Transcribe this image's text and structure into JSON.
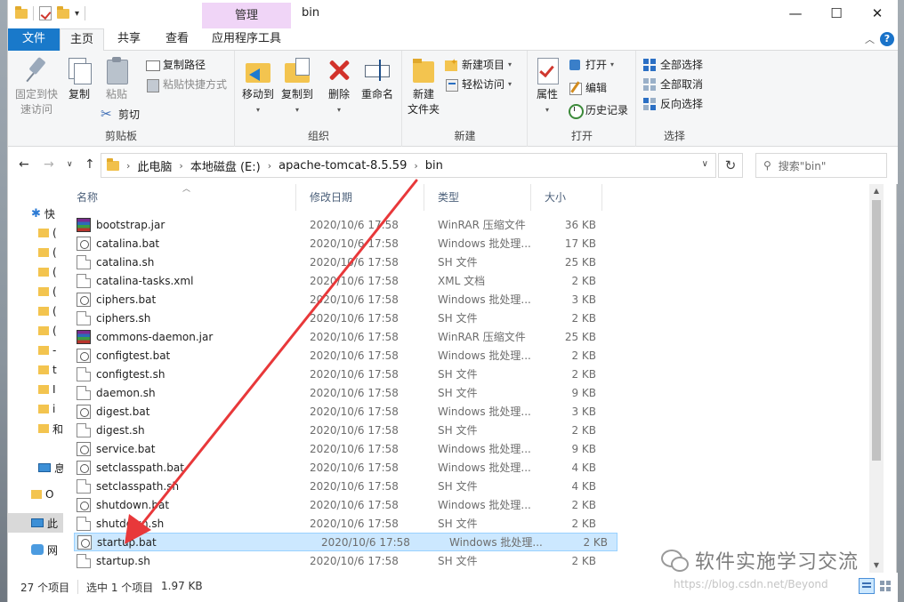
{
  "window": {
    "title": "bin",
    "manage_tab": "管理",
    "minimize": "—",
    "maximize": "☐",
    "close": "✕"
  },
  "tabs": {
    "file": "文件",
    "home": "主页",
    "share": "共享",
    "view": "查看",
    "app_tools": "应用程序工具",
    "help": "?"
  },
  "ribbon": {
    "clipboard": {
      "label": "剪贴板",
      "pin_quick_access": [
        "固定到快",
        "速访问"
      ],
      "copy": "复制",
      "paste": "粘贴",
      "copy_path": "复制路径",
      "paste_shortcut": "粘贴快捷方式",
      "cut": "剪切"
    },
    "organize": {
      "label": "组织",
      "move_to": "移动到",
      "copy_to": "复制到",
      "delete": "删除",
      "rename": "重命名"
    },
    "new": {
      "label": "新建",
      "new_item": "新建项目",
      "easy_access": "轻松访问",
      "new_folder": [
        "新建",
        "文件夹"
      ]
    },
    "open": {
      "label": "打开",
      "properties": "属性",
      "open": "打开",
      "edit": "编辑",
      "history": "历史记录"
    },
    "select": {
      "label": "选择",
      "select_all": "全部选择",
      "select_none": "全部取消",
      "invert": "反向选择"
    }
  },
  "address": {
    "crumbs": [
      "此电脑",
      "本地磁盘 (E:)",
      "apache-tomcat-8.5.59",
      "bin"
    ],
    "search_placeholder": "搜索\"bin\""
  },
  "nav": {
    "items": [
      {
        "label": "快",
        "kind": "star"
      },
      {
        "label": "(",
        "kind": "folder"
      },
      {
        "label": "(",
        "kind": "folder"
      },
      {
        "label": "(",
        "kind": "folder"
      },
      {
        "label": "(",
        "kind": "folder"
      },
      {
        "label": "(",
        "kind": "folder"
      },
      {
        "label": "(",
        "kind": "folder"
      },
      {
        "label": "-",
        "kind": "folder"
      },
      {
        "label": "t",
        "kind": "folder"
      },
      {
        "label": "I",
        "kind": "folder"
      },
      {
        "label": "i",
        "kind": "folder"
      },
      {
        "label": "和",
        "kind": "folder"
      },
      {
        "label": "息",
        "kind": "pc"
      },
      {
        "label": "O",
        "kind": "folder"
      },
      {
        "label": "此",
        "kind": "pc"
      },
      {
        "label": "网",
        "kind": "net"
      }
    ]
  },
  "columns": {
    "name": "名称",
    "date": "修改日期",
    "type": "类型",
    "size": "大小"
  },
  "files": [
    {
      "name": "bootstrap.jar",
      "date": "2020/10/6 17:58",
      "type": "WinRAR 压缩文件",
      "size": "36 KB",
      "icon": "jar"
    },
    {
      "name": "catalina.bat",
      "date": "2020/10/6 17:58",
      "type": "Windows 批处理...",
      "size": "17 KB",
      "icon": "bat"
    },
    {
      "name": "catalina.sh",
      "date": "2020/10/6 17:58",
      "type": "SH 文件",
      "size": "25 KB",
      "icon": "sh"
    },
    {
      "name": "catalina-tasks.xml",
      "date": "2020/10/6 17:58",
      "type": "XML 文档",
      "size": "2 KB",
      "icon": "xml"
    },
    {
      "name": "ciphers.bat",
      "date": "2020/10/6 17:58",
      "type": "Windows 批处理...",
      "size": "3 KB",
      "icon": "bat"
    },
    {
      "name": "ciphers.sh",
      "date": "2020/10/6 17:58",
      "type": "SH 文件",
      "size": "2 KB",
      "icon": "sh"
    },
    {
      "name": "commons-daemon.jar",
      "date": "2020/10/6 17:58",
      "type": "WinRAR 压缩文件",
      "size": "25 KB",
      "icon": "jar"
    },
    {
      "name": "configtest.bat",
      "date": "2020/10/6 17:58",
      "type": "Windows 批处理...",
      "size": "2 KB",
      "icon": "bat"
    },
    {
      "name": "configtest.sh",
      "date": "2020/10/6 17:58",
      "type": "SH 文件",
      "size": "2 KB",
      "icon": "sh"
    },
    {
      "name": "daemon.sh",
      "date": "2020/10/6 17:58",
      "type": "SH 文件",
      "size": "9 KB",
      "icon": "sh"
    },
    {
      "name": "digest.bat",
      "date": "2020/10/6 17:58",
      "type": "Windows 批处理...",
      "size": "3 KB",
      "icon": "bat"
    },
    {
      "name": "digest.sh",
      "date": "2020/10/6 17:58",
      "type": "SH 文件",
      "size": "2 KB",
      "icon": "sh"
    },
    {
      "name": "service.bat",
      "date": "2020/10/6 17:58",
      "type": "Windows 批处理...",
      "size": "9 KB",
      "icon": "bat"
    },
    {
      "name": "setclasspath.bat",
      "date": "2020/10/6 17:58",
      "type": "Windows 批处理...",
      "size": "4 KB",
      "icon": "bat"
    },
    {
      "name": "setclasspath.sh",
      "date": "2020/10/6 17:58",
      "type": "SH 文件",
      "size": "4 KB",
      "icon": "sh"
    },
    {
      "name": "shutdown.bat",
      "date": "2020/10/6 17:58",
      "type": "Windows 批处理...",
      "size": "2 KB",
      "icon": "bat"
    },
    {
      "name": "shutdown.sh",
      "date": "2020/10/6 17:58",
      "type": "SH 文件",
      "size": "2 KB",
      "icon": "sh"
    },
    {
      "name": "startup.bat",
      "date": "2020/10/6 17:58",
      "type": "Windows 批处理...",
      "size": "2 KB",
      "icon": "bat",
      "selected": true
    },
    {
      "name": "startup.sh",
      "date": "2020/10/6 17:58",
      "type": "SH 文件",
      "size": "2 KB",
      "icon": "sh"
    }
  ],
  "status": {
    "count": "27 个项目",
    "selected": "选中 1 个项目",
    "size": "1.97 KB",
    "watermark_url": "https://blog.csdn.net/Beyond"
  },
  "overlay": {
    "wechat_text": "软件实施学习交流"
  },
  "colors": {
    "accent": "#1979ca",
    "selection": "#cce8ff",
    "arrow": "#e8383a"
  }
}
